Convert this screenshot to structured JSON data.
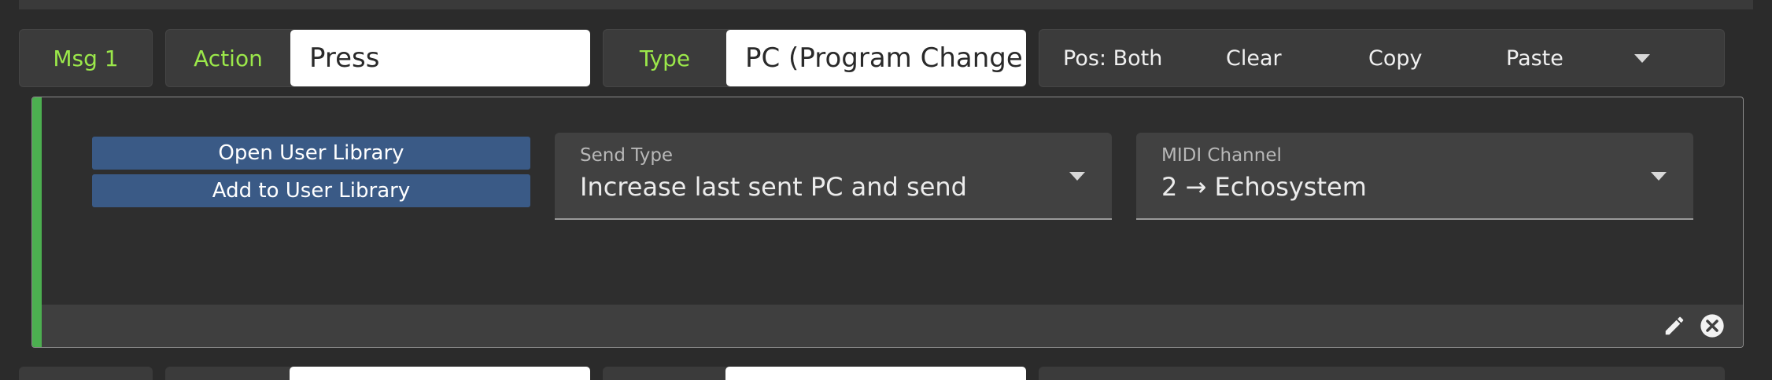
{
  "message_row": {
    "msg_label": "Msg 1",
    "action_label": "Action",
    "action_value": "Press",
    "type_label": "Type",
    "type_value": "PC (Program Change",
    "menu": {
      "pos": "Pos: Both",
      "clear": "Clear",
      "copy": "Copy",
      "paste": "Paste"
    }
  },
  "panel": {
    "open_library": "Open User Library",
    "add_library": "Add to User Library",
    "send_type": {
      "label": "Send Type",
      "value": "Increase last sent PC and send"
    },
    "midi_channel": {
      "label": "MIDI Channel",
      "value": "2 → Echosystem"
    },
    "accent_color": "#4caf50"
  },
  "icons": [
    "chevron-down-icon",
    "pencil-icon",
    "close-circle-icon"
  ],
  "colors": {
    "green_text": "#9be84a",
    "library_button": "#3a5a86",
    "background": "#2b2b2b"
  }
}
